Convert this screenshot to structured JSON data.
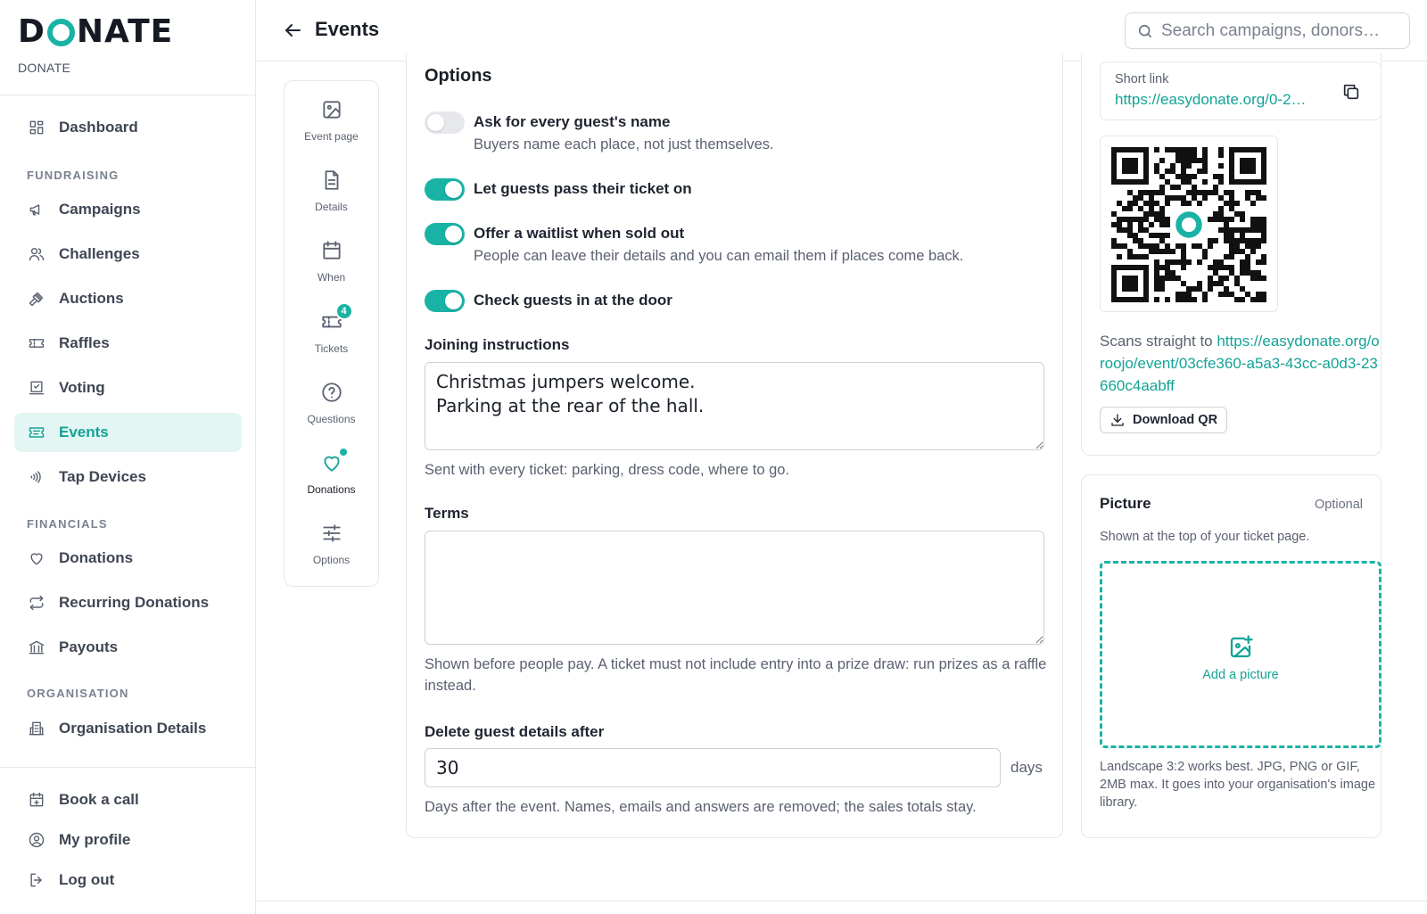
{
  "brand": {
    "logo_prefix": "D",
    "logo_suffix": "NATE",
    "org_name": "DONATE"
  },
  "sidebar": {
    "top_items": [
      {
        "label": "Dashboard",
        "icon": "grid-icon"
      }
    ],
    "sections": [
      {
        "title": "FUNDRAISING",
        "items": [
          {
            "label": "Campaigns",
            "icon": "megaphone-icon"
          },
          {
            "label": "Challenges",
            "icon": "users-icon"
          },
          {
            "label": "Auctions",
            "icon": "gavel-icon"
          },
          {
            "label": "Raffles",
            "icon": "ticket-icon"
          },
          {
            "label": "Voting",
            "icon": "ballot-icon"
          },
          {
            "label": "Events",
            "icon": "event-ticket-icon",
            "active": true
          },
          {
            "label": "Tap Devices",
            "icon": "contactless-icon"
          }
        ]
      },
      {
        "title": "FINANCIALS",
        "items": [
          {
            "label": "Donations",
            "icon": "heart-icon"
          },
          {
            "label": "Recurring Donations",
            "icon": "repeat-icon"
          },
          {
            "label": "Payouts",
            "icon": "bank-icon"
          }
        ]
      },
      {
        "title": "ORGANISATION",
        "items": [
          {
            "label": "Organisation Details",
            "icon": "building-icon"
          }
        ]
      }
    ],
    "bottom_items": [
      {
        "label": "Book a call",
        "icon": "calendar-plus-icon"
      },
      {
        "label": "My profile",
        "icon": "user-circle-icon"
      },
      {
        "label": "Log out",
        "icon": "logout-icon"
      }
    ]
  },
  "header": {
    "title": "Events",
    "search_placeholder": "Search campaigns, donors…"
  },
  "steps": [
    {
      "label": "Event page",
      "icon": "image-icon"
    },
    {
      "label": "Details",
      "icon": "document-icon"
    },
    {
      "label": "When",
      "icon": "calendar-icon"
    },
    {
      "label": "Tickets",
      "icon": "ticket-icon",
      "badge": "4"
    },
    {
      "label": "Questions",
      "icon": "question-icon"
    },
    {
      "label": "Donations",
      "icon": "heart-icon",
      "active": true,
      "dot": true
    },
    {
      "label": "Options",
      "icon": "sliders-icon"
    }
  ],
  "options": {
    "title": "Options",
    "toggles": [
      {
        "label": "Ask for every guest's name",
        "help": "Buyers name each place, not just themselves.",
        "on": false
      },
      {
        "label": "Let guests pass their ticket on",
        "help": "",
        "on": true
      },
      {
        "label": "Offer a waitlist when sold out",
        "help": "People can leave their details and you can email them if places come back.",
        "on": true
      },
      {
        "label": "Check guests in at the door",
        "help": "",
        "on": true
      }
    ],
    "joining": {
      "label": "Joining instructions",
      "value": "Christmas jumpers welcome.\nParking at the rear of the hall.",
      "help": "Sent with every ticket: parking, dress code, where to go."
    },
    "terms": {
      "label": "Terms",
      "value": "",
      "help": "Shown before people pay. A ticket must not include entry into a prize draw: run prizes as a raffle instead."
    },
    "delete_after": {
      "label": "Delete guest details after",
      "value": "30",
      "unit": "days",
      "help": "Days after the event. Names, emails and answers are removed; the sales totals stay."
    }
  },
  "share": {
    "short_link_label": "Short link",
    "short_link_url": "https://easydonate.org/0-2…",
    "scan_prefix": "Scans straight to ",
    "scan_url": "https://easydonate.org/oroojo/event/03cfe360-a5a3-43cc-a0d3-23660c4aabff",
    "download_label": "Download QR"
  },
  "picture": {
    "title": "Picture",
    "optional": "Optional",
    "help": "Shown at the top of your ticket page.",
    "add_label": "Add a picture",
    "footer": "Landscape 3:2 works best. JPG, PNG or GIF, 2MB max. It goes into your organisation's image library."
  },
  "colors": {
    "accent": "#19b3a5",
    "accent_text": "#13a396",
    "active_bg": "#e4f6f3"
  }
}
